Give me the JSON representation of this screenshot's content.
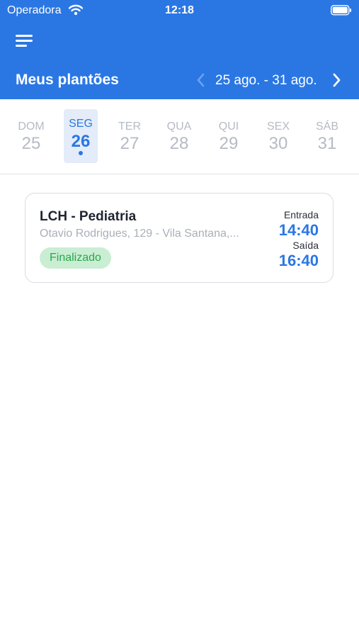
{
  "status_bar": {
    "carrier": "Operadora",
    "time": "12:18",
    "icons": [
      "wifi-icon",
      "battery-icon"
    ]
  },
  "header": {
    "menu_icon": "hamburger-menu-icon",
    "title": "Meus plantões",
    "date_range": "25 ago. - 31 ago.",
    "prev_icon": "chevron-left-icon",
    "next_icon": "chevron-right-icon"
  },
  "week": {
    "days": [
      {
        "name": "DOM",
        "number": "25",
        "selected": false
      },
      {
        "name": "SEG",
        "number": "26",
        "selected": true,
        "has_event": true
      },
      {
        "name": "TER",
        "number": "27",
        "selected": false
      },
      {
        "name": "QUA",
        "number": "28",
        "selected": false
      },
      {
        "name": "QUI",
        "number": "29",
        "selected": false
      },
      {
        "name": "SEX",
        "number": "30",
        "selected": false
      },
      {
        "name": "SÁB",
        "number": "31",
        "selected": false
      }
    ]
  },
  "shifts": [
    {
      "title": "LCH - Pediatria",
      "address": "Otavio Rodrigues, 129 - Vila Santana,...",
      "status": "Finalizado",
      "entry_label": "Entrada",
      "entry_time": "14:40",
      "exit_label": "Saída",
      "exit_time": "16:40"
    }
  ],
  "colors": {
    "primary": "#2a77e4",
    "selected_day_bg": "#e3ecf8",
    "status_badge_bg": "#c9eed3",
    "status_badge_text": "#2aa64e",
    "muted_text": "#b5bbc4"
  }
}
